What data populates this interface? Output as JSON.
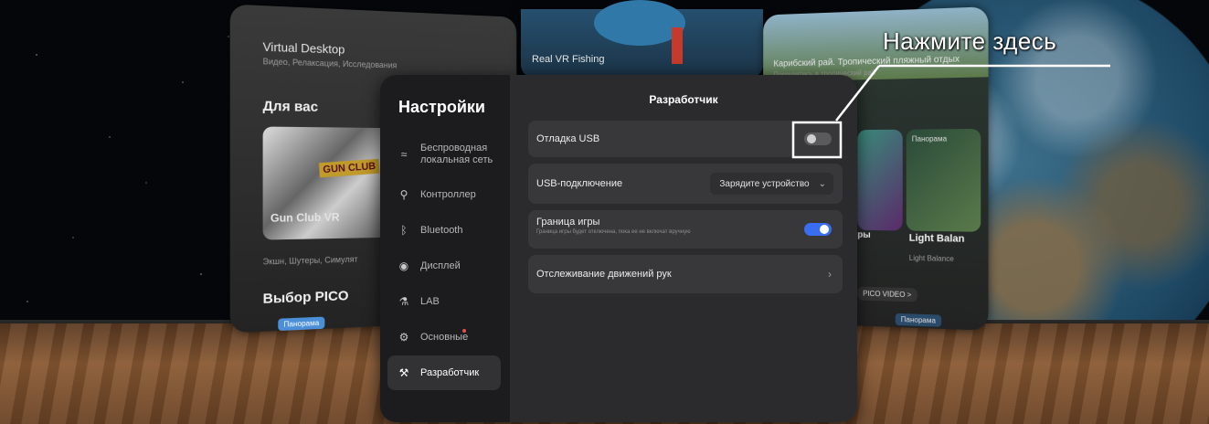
{
  "background": {
    "left_panel": {
      "app_title_partial": "Virtual Desktop",
      "app_subtitle_partial": "Видео, Релаксация, Исследования",
      "section_for_you": "Для вас",
      "game_title": "Gun Club VR",
      "game_tags": "Экшн, Шутеры, Симулят",
      "section_pico_choice": "Выбор PICO",
      "badge": "Панорама",
      "logo_text": "GUN CLUB VR",
      "logo_small": "GUN CLUB"
    },
    "mid_panel": {
      "app_title": "Real VR Fishing"
    },
    "right_panel": {
      "title_partial": "Карибский рай. Тропический пляжный отдых",
      "subtitle_partial": "Погрузитесь в тропический рай",
      "tile_label": "Панорама",
      "game_partial": "Light Balan",
      "game_tags_partial": "Light Balance",
      "side_partial": "ры",
      "pico_video": "PICO VIDEO >",
      "panorama_badge": "Панорама"
    }
  },
  "settings": {
    "title": "Настройки",
    "nav": [
      {
        "icon": "wifi-icon",
        "glyph": "≈",
        "label": "Беспроводная локальная сеть"
      },
      {
        "icon": "controller-icon",
        "glyph": "⚲",
        "label": "Контроллер"
      },
      {
        "icon": "bluetooth-icon",
        "glyph": "ᛒ",
        "label": "Bluetooth"
      },
      {
        "icon": "display-icon",
        "glyph": "◉",
        "label": "Дисплей"
      },
      {
        "icon": "lab-icon",
        "glyph": "⚗",
        "label": "LAB"
      },
      {
        "icon": "general-icon",
        "glyph": "⚙",
        "label": "Основные"
      },
      {
        "icon": "developer-icon",
        "glyph": "⚒",
        "label": "Разработчик"
      }
    ],
    "active_nav": "Разработчик",
    "section_title": "Разработчик",
    "rows": {
      "usb_debug": {
        "label": "Отладка USB",
        "state": "off"
      },
      "usb_connection": {
        "label": "USB-подключение",
        "value": "Зарядите устройство"
      },
      "game_boundary": {
        "label": "Граница игры",
        "description": "Граница игры будет отключена, пока ее не включат вручную",
        "state": "on"
      },
      "hand_tracking": {
        "label": "Отслеживание движений рук"
      }
    }
  },
  "callout": {
    "text": "Нажмите здесь"
  },
  "colors": {
    "toggle_on": "#3a6ef0",
    "toggle_off": "#5a5a5d",
    "modal_bg": "#2b2b2d",
    "sidebar_bg": "#1c1c1e"
  }
}
